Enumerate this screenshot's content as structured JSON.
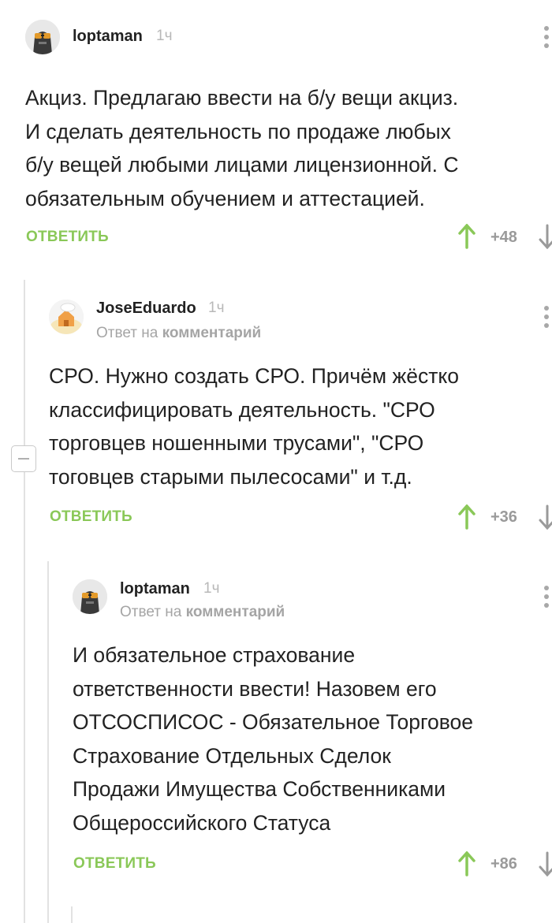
{
  "comments": [
    {
      "username": "loptaman",
      "time": "1ч",
      "avatar": "robot-sunglasses-avatar",
      "reply_to_prefix": "",
      "reply_to_target": "",
      "text": "Акциз. Предлагаю ввести на б/у вещи акциз.\nИ сделать деятельность по продаже любых\nб/у вещей любыми лицами лицензионной. С\nобязательным обучением и аттестацией.",
      "reply_label": "ОТВЕТИТЬ",
      "rating": "+48"
    },
    {
      "username": "JoseEduardo",
      "time": "1ч",
      "avatar": "cartoon-house-avatar",
      "reply_to_prefix": "Ответ на",
      "reply_to_target": "комментарий",
      "text": "СРО. Нужно создать СРО. Причём жёстко\nклассифицировать деятельность. \"СРО\nторговцев ношенными трусами\", \"СРО\nтоговцев старыми пылесосами\" и т.д.",
      "reply_label": "ОТВЕТИТЬ",
      "rating": "+36"
    },
    {
      "username": "loptaman",
      "time": "1ч",
      "avatar": "robot-sunglasses-avatar",
      "reply_to_prefix": "Ответ на",
      "reply_to_target": "комментарий",
      "text": "И обязательное страхование\nответственности ввести! Назовем его\nОТСОСПИСОС - Обязательное Торговое\nСтрахование Отдельных Сделок\nПродажи Имущества Собственниками\nОбщероссийского Статуса",
      "reply_label": "ОТВЕТИТЬ",
      "rating": "+86"
    }
  ],
  "colors": {
    "reply_green": "#8ac858",
    "upvote_green": "#8ac858",
    "thread_line": "#e2e2e2",
    "muted_text": "#a5a5a5"
  },
  "icons": [
    "more-vertical-icon",
    "upvote-arrow-icon",
    "downvote-arrow-icon",
    "collapse-minus-icon"
  ]
}
